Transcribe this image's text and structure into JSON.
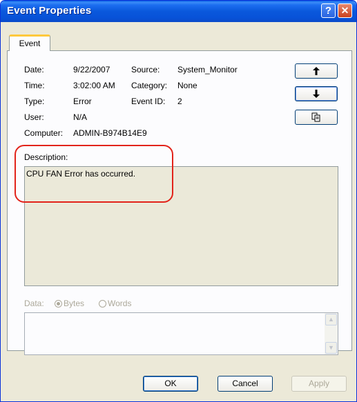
{
  "window": {
    "title": "Event Properties",
    "help_icon": "question-mark",
    "close_icon": "x"
  },
  "tab": {
    "label": "Event"
  },
  "fields": {
    "date_label": "Date:",
    "date_value": "9/22/2007",
    "source_label": "Source:",
    "source_value": "System_Monitor",
    "time_label": "Time:",
    "time_value": "3:02:00 AM",
    "category_label": "Category:",
    "category_value": "None",
    "type_label": "Type:",
    "type_value": "Error",
    "eventid_label": "Event ID:",
    "eventid_value": "2",
    "user_label": "User:",
    "user_value": "N/A",
    "computer_label": "Computer:",
    "computer_value": "ADMIN-B974B14E9"
  },
  "nav": {
    "up": "🠉",
    "down": "🠋",
    "copy": "⧉"
  },
  "description": {
    "label": "Description:",
    "text": "CPU FAN Error has occurred."
  },
  "data": {
    "label": "Data:",
    "bytes": "Bytes",
    "words": "Words",
    "selected": "Bytes"
  },
  "buttons": {
    "ok": "OK",
    "cancel": "Cancel",
    "apply": "Apply"
  },
  "colors": {
    "titlebar": "#0a58dc",
    "highlight": "#e2231a",
    "tab_accent": "#ffc83c"
  }
}
